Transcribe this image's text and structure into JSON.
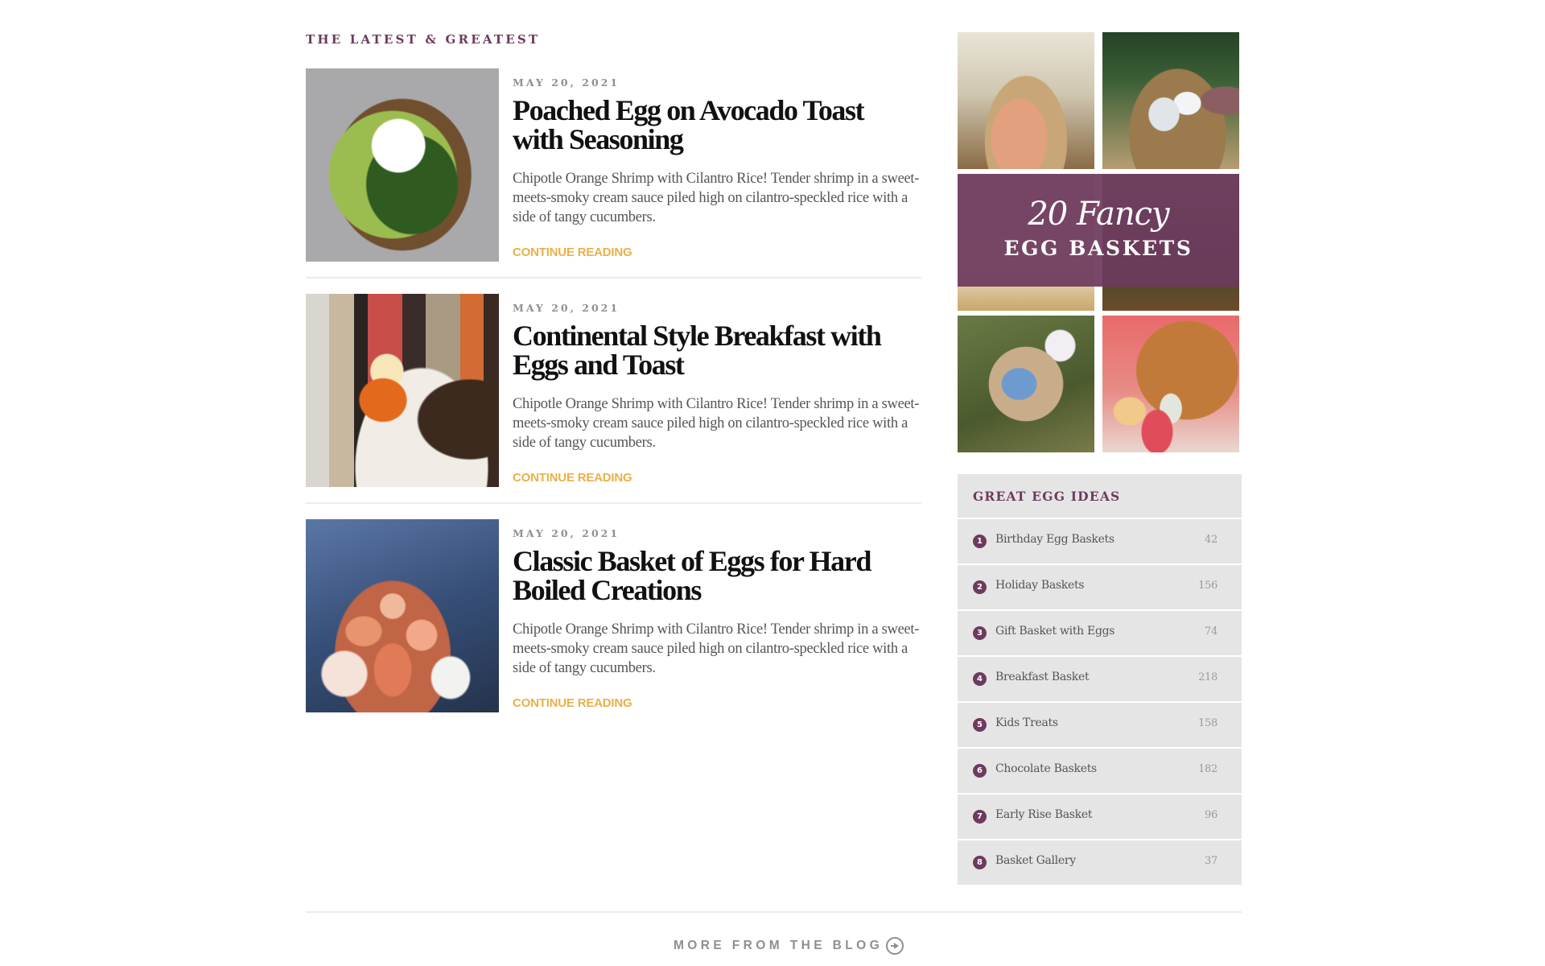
{
  "section_title": "THE LATEST & GREATEST",
  "colors": {
    "accent": "#6e3a5e",
    "link": "#e8b04a",
    "widget_bg": "#e5e5e5"
  },
  "posts": [
    {
      "date": "MAY 20, 2021",
      "title": "Poached Egg on Avocado Toast with Seasoning",
      "excerpt": "Chipotle Orange Shrimp with Cilantro Rice! Tender shrimp in a sweet-meets-smoky cream sauce piled high on cilantro-speckled rice with a side of tangy cucumbers.",
      "link": "CONTINUE READING"
    },
    {
      "date": "MAY 20, 2021",
      "title": "Continental Style Breakfast with Eggs and Toast",
      "excerpt": "Chipotle Orange Shrimp with Cilantro Rice! Tender shrimp in a sweet-meets-smoky cream sauce piled high on cilantro-speckled rice with a side of tangy cucumbers.",
      "link": "CONTINUE READING"
    },
    {
      "date": "MAY 20, 2021",
      "title": "Classic Basket of Eggs for Hard Boiled Creations",
      "excerpt": "Chipotle Orange Shrimp with Cilantro Rice! Tender shrimp in a sweet-meets-smoky cream sauce piled high on cilantro-speckled rice with a side of tangy cucumbers.",
      "link": "CONTINUE READING"
    }
  ],
  "promo": {
    "script_line": "20 Fancy",
    "title_line": "EGG BASKETS"
  },
  "widget": {
    "title": "GREAT EGG IDEAS",
    "items": [
      {
        "num": "1",
        "label": "Birthday Egg Baskets",
        "count": "42"
      },
      {
        "num": "2",
        "label": "Holiday Baskets",
        "count": "156"
      },
      {
        "num": "3",
        "label": "Gift Basket with Eggs",
        "count": "74"
      },
      {
        "num": "4",
        "label": "Breakfast Basket",
        "count": "218"
      },
      {
        "num": "5",
        "label": "Kids Treats",
        "count": "158"
      },
      {
        "num": "6",
        "label": "Chocolate Baskets",
        "count": "182"
      },
      {
        "num": "7",
        "label": "Early Rise Basket",
        "count": "96"
      },
      {
        "num": "8",
        "label": "Basket Gallery",
        "count": "37"
      }
    ]
  },
  "footer": {
    "more_label": "MORE FROM THE BLOG",
    "more_icon": "arrow-circle-right-icon"
  }
}
